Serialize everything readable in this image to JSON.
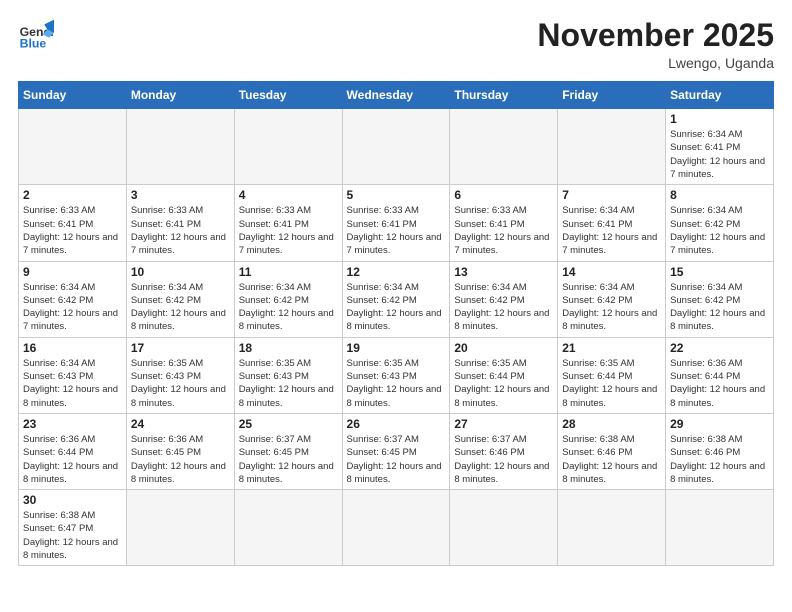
{
  "logo": {
    "line1": "General",
    "line2": "Blue"
  },
  "title": "November 2025",
  "subtitle": "Lwengo, Uganda",
  "weekdays": [
    "Sunday",
    "Monday",
    "Tuesday",
    "Wednesday",
    "Thursday",
    "Friday",
    "Saturday"
  ],
  "weeks": [
    [
      {
        "day": "",
        "empty": true
      },
      {
        "day": "",
        "empty": true
      },
      {
        "day": "",
        "empty": true
      },
      {
        "day": "",
        "empty": true
      },
      {
        "day": "",
        "empty": true
      },
      {
        "day": "",
        "empty": true
      },
      {
        "day": "1",
        "info": "Sunrise: 6:34 AM\nSunset: 6:41 PM\nDaylight: 12 hours and 7 minutes."
      }
    ],
    [
      {
        "day": "2",
        "info": "Sunrise: 6:33 AM\nSunset: 6:41 PM\nDaylight: 12 hours and 7 minutes."
      },
      {
        "day": "3",
        "info": "Sunrise: 6:33 AM\nSunset: 6:41 PM\nDaylight: 12 hours and 7 minutes."
      },
      {
        "day": "4",
        "info": "Sunrise: 6:33 AM\nSunset: 6:41 PM\nDaylight: 12 hours and 7 minutes."
      },
      {
        "day": "5",
        "info": "Sunrise: 6:33 AM\nSunset: 6:41 PM\nDaylight: 12 hours and 7 minutes."
      },
      {
        "day": "6",
        "info": "Sunrise: 6:33 AM\nSunset: 6:41 PM\nDaylight: 12 hours and 7 minutes."
      },
      {
        "day": "7",
        "info": "Sunrise: 6:34 AM\nSunset: 6:41 PM\nDaylight: 12 hours and 7 minutes."
      },
      {
        "day": "8",
        "info": "Sunrise: 6:34 AM\nSunset: 6:42 PM\nDaylight: 12 hours and 7 minutes."
      }
    ],
    [
      {
        "day": "9",
        "info": "Sunrise: 6:34 AM\nSunset: 6:42 PM\nDaylight: 12 hours and 7 minutes."
      },
      {
        "day": "10",
        "info": "Sunrise: 6:34 AM\nSunset: 6:42 PM\nDaylight: 12 hours and 8 minutes."
      },
      {
        "day": "11",
        "info": "Sunrise: 6:34 AM\nSunset: 6:42 PM\nDaylight: 12 hours and 8 minutes."
      },
      {
        "day": "12",
        "info": "Sunrise: 6:34 AM\nSunset: 6:42 PM\nDaylight: 12 hours and 8 minutes."
      },
      {
        "day": "13",
        "info": "Sunrise: 6:34 AM\nSunset: 6:42 PM\nDaylight: 12 hours and 8 minutes."
      },
      {
        "day": "14",
        "info": "Sunrise: 6:34 AM\nSunset: 6:42 PM\nDaylight: 12 hours and 8 minutes."
      },
      {
        "day": "15",
        "info": "Sunrise: 6:34 AM\nSunset: 6:42 PM\nDaylight: 12 hours and 8 minutes."
      }
    ],
    [
      {
        "day": "16",
        "info": "Sunrise: 6:34 AM\nSunset: 6:43 PM\nDaylight: 12 hours and 8 minutes."
      },
      {
        "day": "17",
        "info": "Sunrise: 6:35 AM\nSunset: 6:43 PM\nDaylight: 12 hours and 8 minutes."
      },
      {
        "day": "18",
        "info": "Sunrise: 6:35 AM\nSunset: 6:43 PM\nDaylight: 12 hours and 8 minutes."
      },
      {
        "day": "19",
        "info": "Sunrise: 6:35 AM\nSunset: 6:43 PM\nDaylight: 12 hours and 8 minutes."
      },
      {
        "day": "20",
        "info": "Sunrise: 6:35 AM\nSunset: 6:44 PM\nDaylight: 12 hours and 8 minutes."
      },
      {
        "day": "21",
        "info": "Sunrise: 6:35 AM\nSunset: 6:44 PM\nDaylight: 12 hours and 8 minutes."
      },
      {
        "day": "22",
        "info": "Sunrise: 6:36 AM\nSunset: 6:44 PM\nDaylight: 12 hours and 8 minutes."
      }
    ],
    [
      {
        "day": "23",
        "info": "Sunrise: 6:36 AM\nSunset: 6:44 PM\nDaylight: 12 hours and 8 minutes."
      },
      {
        "day": "24",
        "info": "Sunrise: 6:36 AM\nSunset: 6:45 PM\nDaylight: 12 hours and 8 minutes."
      },
      {
        "day": "25",
        "info": "Sunrise: 6:37 AM\nSunset: 6:45 PM\nDaylight: 12 hours and 8 minutes."
      },
      {
        "day": "26",
        "info": "Sunrise: 6:37 AM\nSunset: 6:45 PM\nDaylight: 12 hours and 8 minutes."
      },
      {
        "day": "27",
        "info": "Sunrise: 6:37 AM\nSunset: 6:46 PM\nDaylight: 12 hours and 8 minutes."
      },
      {
        "day": "28",
        "info": "Sunrise: 6:38 AM\nSunset: 6:46 PM\nDaylight: 12 hours and 8 minutes."
      },
      {
        "day": "29",
        "info": "Sunrise: 6:38 AM\nSunset: 6:46 PM\nDaylight: 12 hours and 8 minutes."
      }
    ],
    [
      {
        "day": "30",
        "info": "Sunrise: 6:38 AM\nSunset: 6:47 PM\nDaylight: 12 hours and 8 minutes."
      },
      {
        "day": "",
        "empty": true
      },
      {
        "day": "",
        "empty": true
      },
      {
        "day": "",
        "empty": true
      },
      {
        "day": "",
        "empty": true
      },
      {
        "day": "",
        "empty": true
      },
      {
        "day": "",
        "empty": true
      }
    ]
  ]
}
